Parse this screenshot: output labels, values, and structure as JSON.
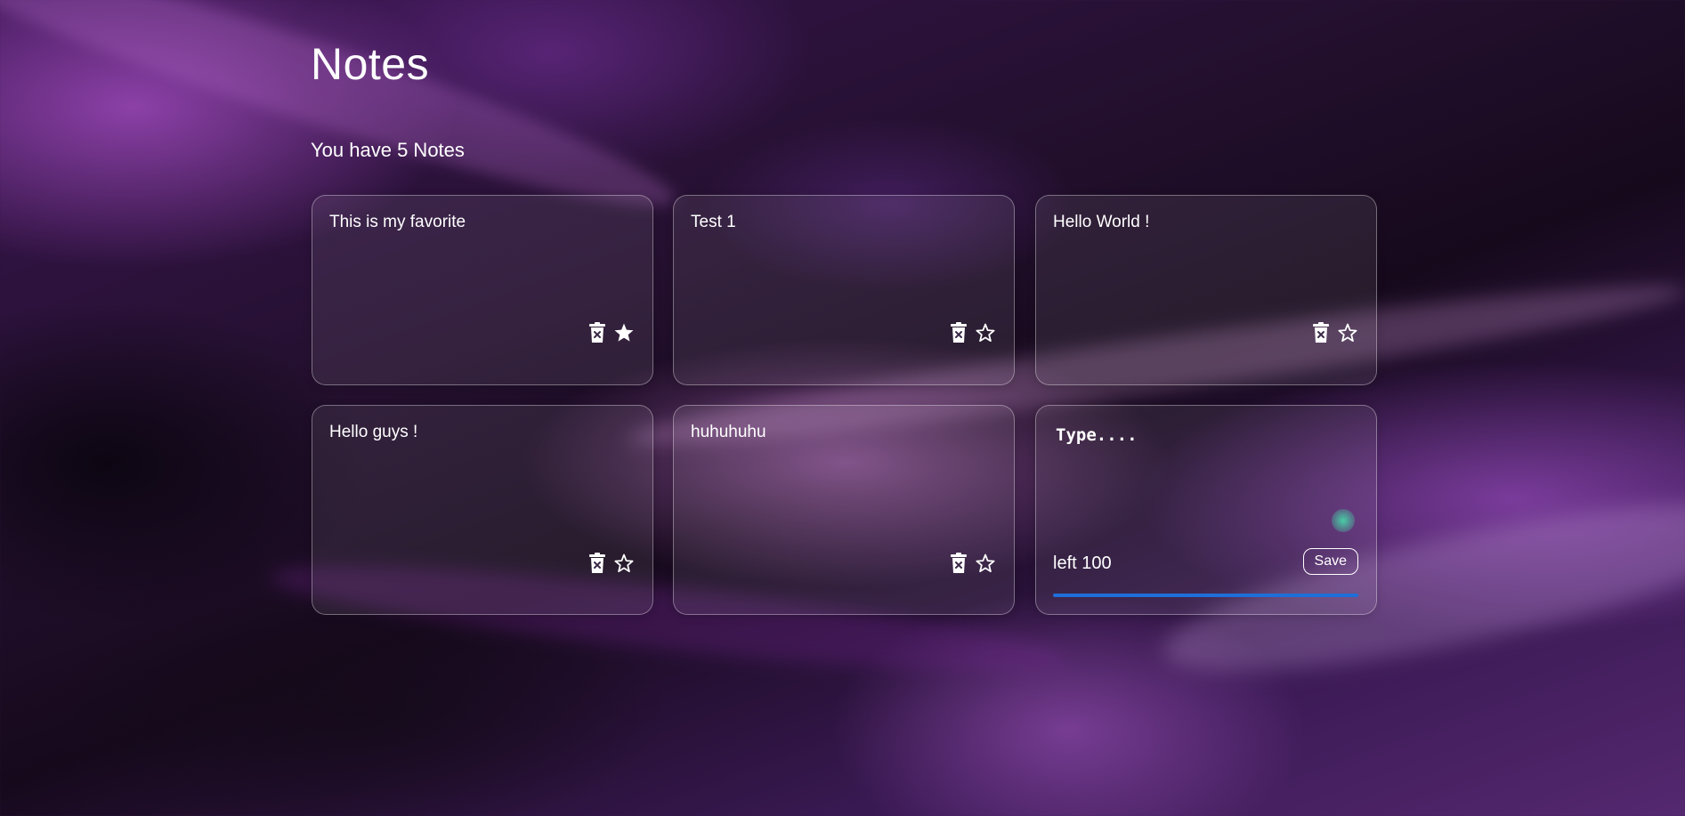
{
  "app": {
    "title": "Notes",
    "count_prefix": "You have ",
    "count": "5",
    "count_suffix": " Notes"
  },
  "notes": [
    {
      "text": "This is my favorite",
      "favorite": true
    },
    {
      "text": "Test 1",
      "favorite": false
    },
    {
      "text": "Hello World !",
      "favorite": false
    },
    {
      "text": "Hello guys !",
      "favorite": false
    },
    {
      "text": "huhuhuhu",
      "favorite": false
    }
  ],
  "composer": {
    "placeholder": "Type....",
    "remaining_label": "left 100",
    "save_label": "Save",
    "progress_fraction": 1.0
  },
  "icons": {
    "delete": "trash-x-icon",
    "favorite_on": "star-filled-icon",
    "favorite_off": "star-outline-icon"
  },
  "colors": {
    "progress": "#1e6fd9",
    "text": "#ffffff"
  }
}
